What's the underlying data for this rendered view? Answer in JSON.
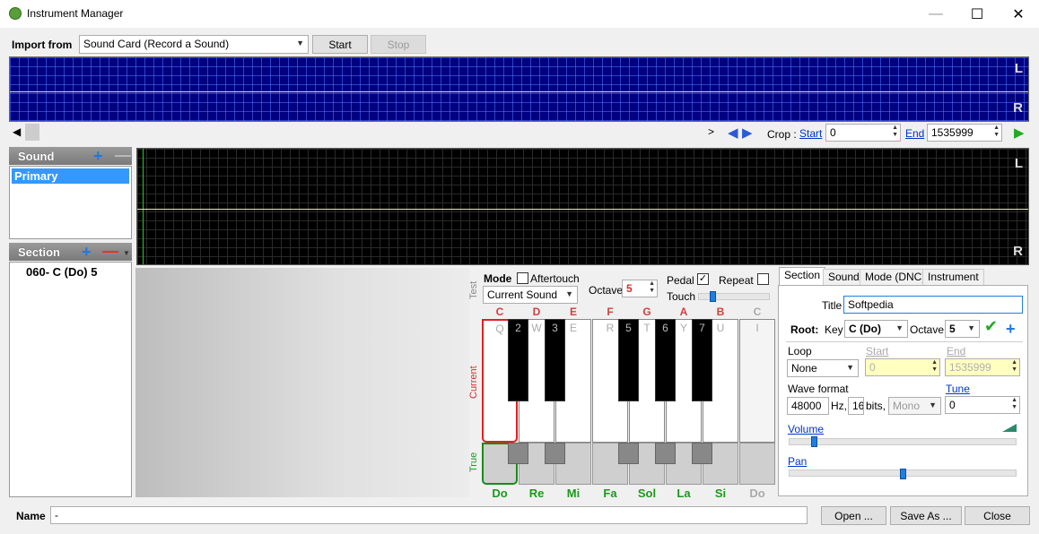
{
  "window": {
    "title": "Instrument Manager"
  },
  "colors": {
    "wave_bg": "#000080",
    "wave2_bg": "#000000",
    "selected": "#3399ff",
    "note_red": "#d04040",
    "note_green": "#1a9a1a"
  },
  "toolbar": {
    "import_label": "Import from",
    "import_value": "Sound Card (Record a Sound)",
    "start_label": "Start",
    "stop_label": "Stop"
  },
  "wave": {
    "left_channel": "L",
    "right_channel": "R"
  },
  "crop": {
    "label": "Crop :",
    "start_link": "Start",
    "start_value": "0",
    "end_link": "End",
    "end_value": "1535999"
  },
  "sound_panel": {
    "header": "Sound",
    "items": [
      "Primary"
    ]
  },
  "section_panel": {
    "header": "Section",
    "items": [
      "060- C (Do) 5"
    ]
  },
  "test": {
    "side_label": "Test",
    "mode_label": "Mode",
    "aftertouch_label": "Aftertouch",
    "mode_value": "Current Sound",
    "octave_label": "Octave",
    "octave_value": "5",
    "pedal_label": "Pedal",
    "repeat_label": "Repeat",
    "touch_label": "Touch",
    "current_label": "Current",
    "true_label": "True"
  },
  "keyboard": {
    "top_notes": [
      "C",
      "D",
      "E",
      "F",
      "G",
      "A",
      "B",
      "C"
    ],
    "bottom_notes": [
      "Do",
      "Re",
      "Mi",
      "Fa",
      "Sol",
      "La",
      "Si",
      "Do"
    ],
    "white_keys": [
      "Q",
      "W",
      "E",
      "R",
      "T",
      "Y",
      "U",
      "I"
    ],
    "black_keys": [
      "2",
      "3",
      "5",
      "6",
      "7"
    ]
  },
  "tabs": [
    "Section",
    "Sound",
    "Mode (DNC)",
    "Instrument"
  ],
  "section": {
    "title_label": "Title",
    "title_value": "Softpedia",
    "root_label": "Root:",
    "key_label": "Key",
    "key_value": "C (Do)",
    "octave_label": "Octave",
    "octave_value": "5",
    "loop_label": "Loop",
    "loop_value": "None",
    "start_label": "Start",
    "start_value": "0",
    "end_label": "End",
    "end_value": "1535999",
    "wave_format_label": "Wave format",
    "rate_value": "48000",
    "hz_label": "Hz,",
    "bits_value": "16",
    "bits_label": "bits,",
    "channels_value": "Mono",
    "tune_label": "Tune",
    "tune_value": "0",
    "volume_label": "Volume",
    "pan_label": "Pan",
    "volume_level": 0.1,
    "pan_level": 0.5
  },
  "footer": {
    "name_label": "Name",
    "name_value": "-",
    "open_label": "Open ...",
    "saveas_label": "Save As ...",
    "close_label": "Close"
  }
}
